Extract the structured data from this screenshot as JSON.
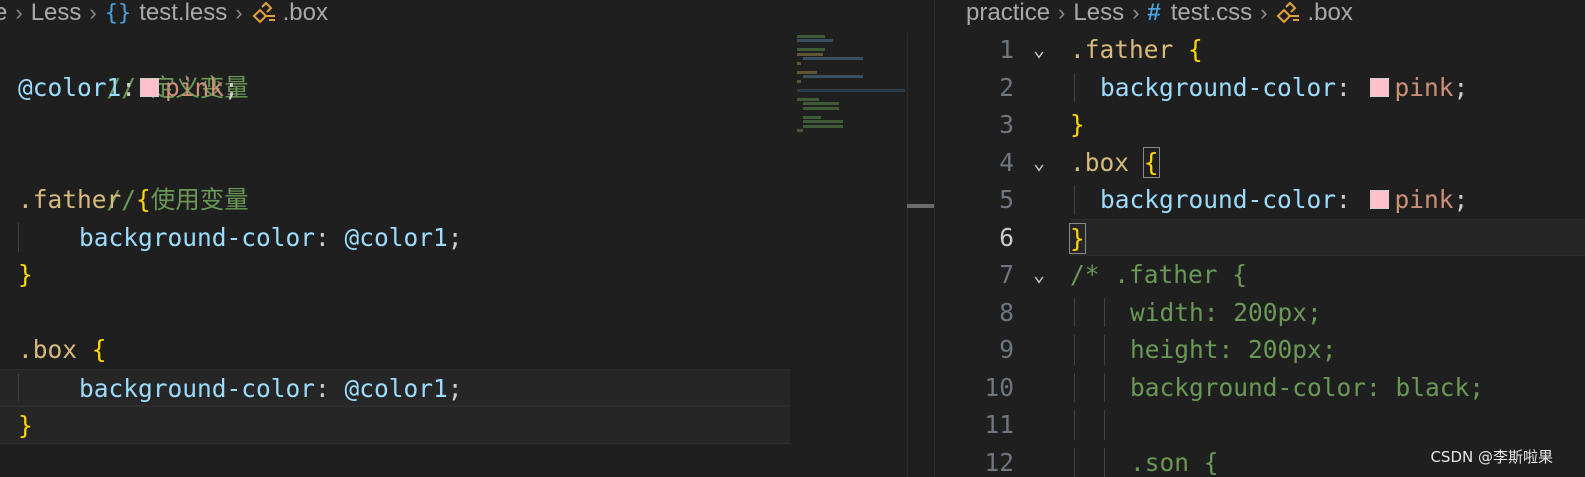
{
  "left_breadcrumb": {
    "partial": "e",
    "folder": "Less",
    "file": "test.less",
    "symbol": ".box"
  },
  "right_breadcrumb": {
    "folder1": "practice",
    "folder2": "Less",
    "file": "test.css",
    "symbol": ".box"
  },
  "left_code": {
    "comment1": "// 定义变量",
    "var_name": "@color1",
    "colon": ":",
    "var_value": "pink",
    "semicolon": ";",
    "comment2": "// 使用变量",
    "sel_father": ".father ",
    "open_brace": "{",
    "close_brace": "}",
    "prop": "background-color",
    "prop_colon": ": ",
    "prop_val": "@color1",
    "sel_box": ".box "
  },
  "right_code": {
    "line_numbers": [
      "1",
      "2",
      "3",
      "4",
      "5",
      "6",
      "7",
      "8",
      "9",
      "10",
      "11",
      "12"
    ],
    "sel_father": ".father ",
    "open_brace": "{",
    "close_brace": "}",
    "prop": "background-color",
    "prop_colon": ": ",
    "val": "pink",
    "semicolon": ";",
    "sel_box": ".box ",
    "comment_start": "/* .father {",
    "c_width": "width: 200px;",
    "c_height": "height: 200px;",
    "c_bg": "background-color: black;",
    "c_son": ".son {"
  },
  "colors": {
    "swatch": "#ffc0cb",
    "background": "#1f1f1f",
    "comment": "#6a9955",
    "selector": "#d7ba7d",
    "property": "#9cdcfe",
    "value": "#ce9178",
    "brace": "#ffd700"
  },
  "watermark": "CSDN @李斯啦果"
}
